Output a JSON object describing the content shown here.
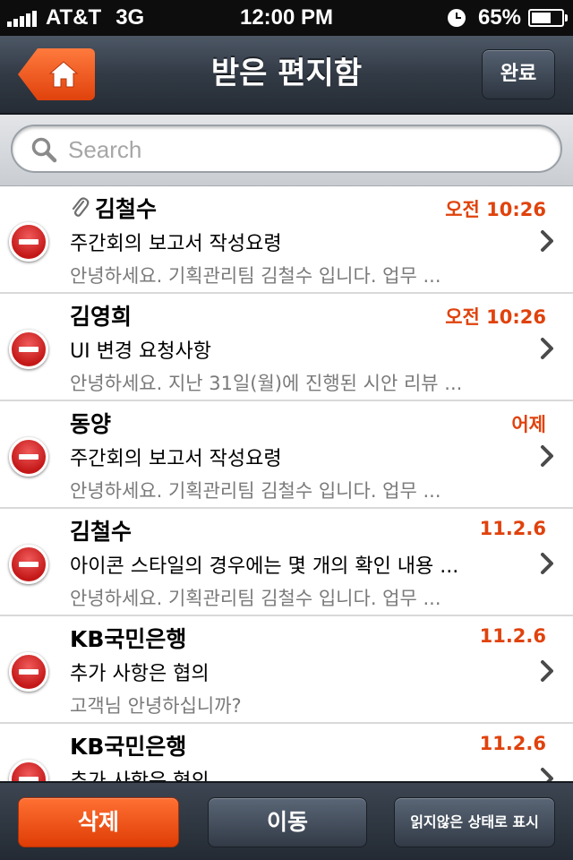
{
  "status_bar": {
    "carrier": "AT&T",
    "network": "3G",
    "time": "12:00 PM",
    "battery": "65%",
    "battery_level": 0.65
  },
  "nav": {
    "title": "받은 편지함",
    "done_label": "완료",
    "home_icon": "home-icon"
  },
  "search": {
    "placeholder": "Search",
    "value": ""
  },
  "mails": [
    {
      "sender": "김철수",
      "date": "오전 10:26",
      "subject": "주간회의 보고서 작성요령",
      "preview": "안녕하세요. 기획관리팀 김철수 입니다. 업무 ...",
      "attachment": true
    },
    {
      "sender": "김영희",
      "date": "오전 10:26",
      "subject": "UI 변경 요청사항",
      "preview": "안녕하세요. 지난 31일(월)에 진행된 시안 리뷰 ...",
      "attachment": false
    },
    {
      "sender": "동양",
      "date": "어제",
      "subject": "주간회의 보고서 작성요령",
      "preview": "안녕하세요. 기획관리팀 김철수 입니다. 업무 ...",
      "attachment": false
    },
    {
      "sender": "김철수",
      "date": "11.2.6",
      "subject": "아이콘 스타일의 경우에는 몇 개의 확인 내용 ...",
      "preview": "안녕하세요. 기획관리팀 김철수 입니다. 업무 ...",
      "attachment": false
    },
    {
      "sender": "KB국민은행",
      "date": "11.2.6",
      "subject": "추가 사항은 협의",
      "preview": "고객님 안녕하십니까?",
      "attachment": false
    },
    {
      "sender": "KB국민은행",
      "date": "11.2.6",
      "subject": "추가 사항은 협의",
      "preview": "",
      "attachment": false
    }
  ],
  "toolbar": {
    "delete_label": "삭제",
    "move_label": "이동",
    "mark_unread_label": "읽지않은 상태로 표시"
  },
  "colors": {
    "accent": "#e0420c",
    "nav_bg": "#323a45",
    "delete_red": "#c41818"
  }
}
